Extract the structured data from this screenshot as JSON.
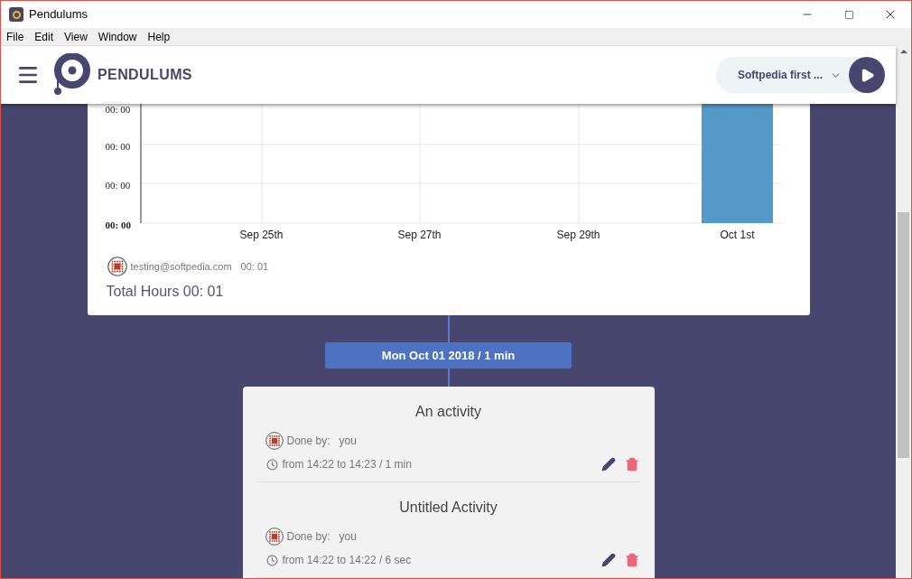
{
  "window": {
    "title": "Pendulums"
  },
  "menu": [
    "File",
    "Edit",
    "View",
    "Window",
    "Help"
  ],
  "header": {
    "brand": "PENDULUMS",
    "project": "Softpedia first ..."
  },
  "chart": {
    "y_labels": [
      "00: 00",
      "00: 00",
      "00: 00",
      "00: 00"
    ],
    "x_labels": [
      "Sep 25th",
      "Sep 27th",
      "Sep 29th",
      "Oct 1st"
    ],
    "user": {
      "email": "testing@softpedia.com",
      "time": "00: 01"
    },
    "total": "Total Hours 00: 01"
  },
  "day": {
    "label": "Mon Oct 01 2018 / 1 min"
  },
  "activities": [
    {
      "title": "An activity",
      "done_label": "Done by:",
      "done_by": "you",
      "time": "from 14:22 to 14:23 / 1 min"
    },
    {
      "title": "Untitled Activity",
      "done_label": "Done by:",
      "done_by": "you",
      "time": "from 14:22 to 14:22 / 6 sec"
    }
  ]
}
